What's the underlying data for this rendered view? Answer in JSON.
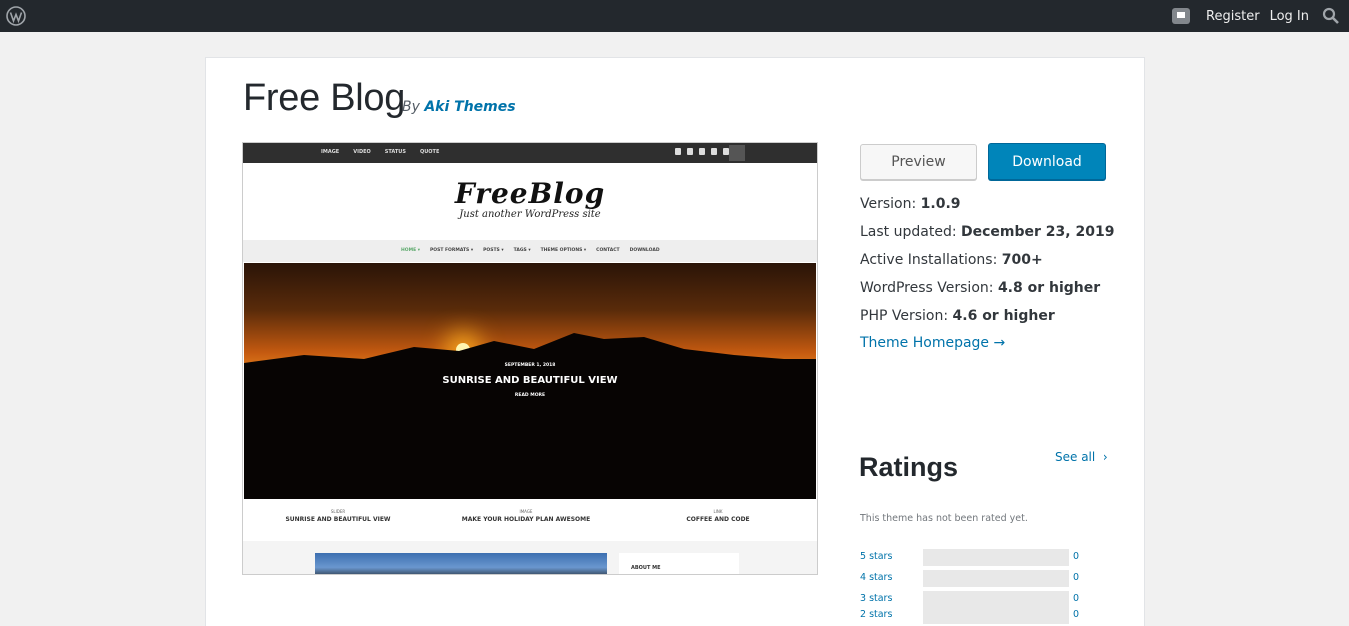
{
  "admin_bar": {
    "register_label": "Register",
    "login_label": "Log In"
  },
  "theme": {
    "title": "Free Blog",
    "by_label": "By",
    "author": "Aki Themes"
  },
  "screenshot": {
    "top_nav": [
      "IMAGE",
      "VIDEO",
      "STATUS",
      "QUOTE"
    ],
    "logo": "FreeBlog",
    "tagline": "Just another WordPress site",
    "menu": [
      "HOME ▾",
      "POST FORMATS ▾",
      "POSTS ▾",
      "TAGS ▾",
      "THEME OPTIONS ▾",
      "CONTACT",
      "DOWNLOAD"
    ],
    "hero_date": "SEPTEMBER 1, 2018",
    "hero_title": "SUNRISE AND BEAUTIFUL VIEW",
    "hero_read": "READ MORE",
    "featured": [
      {
        "category": "SLIDER",
        "title": "SUNRISE AND BEAUTIFUL VIEW"
      },
      {
        "category": "IMAGE",
        "title": "MAKE YOUR HOLIDAY PLAN AWESOME"
      },
      {
        "category": "LINK",
        "title": "COFFEE AND CODE"
      }
    ],
    "about_label": "ABOUT ME"
  },
  "actions": {
    "preview_label": "Preview",
    "download_label": "Download"
  },
  "meta": {
    "version_label": "Version:",
    "version": "1.0.9",
    "updated_label": "Last updated:",
    "updated": "December 23, 2019",
    "installs_label": "Active Installations:",
    "installs": "700+",
    "wp_label": "WordPress Version:",
    "wp_version": "4.8 or higher",
    "php_label": "PHP Version:",
    "php_version": "4.6 or higher",
    "homepage_label": "Theme Homepage →"
  },
  "ratings": {
    "title": "Ratings",
    "see_all": "See all",
    "not_rated": "This theme has not been rated yet.",
    "rows": [
      {
        "label": "5 stars",
        "count": "0"
      },
      {
        "label": "4 stars",
        "count": "0"
      },
      {
        "label": "3 stars",
        "count": "0"
      },
      {
        "label": "2 stars",
        "count": "0"
      }
    ]
  },
  "colors": {
    "admin_bar": "#23282d",
    "link": "#0073aa",
    "download_button": "#0085ba"
  },
  "icons": [
    "wordpress-logo-icon",
    "notification-icon",
    "search-icon",
    "chevron-right-icon"
  ]
}
